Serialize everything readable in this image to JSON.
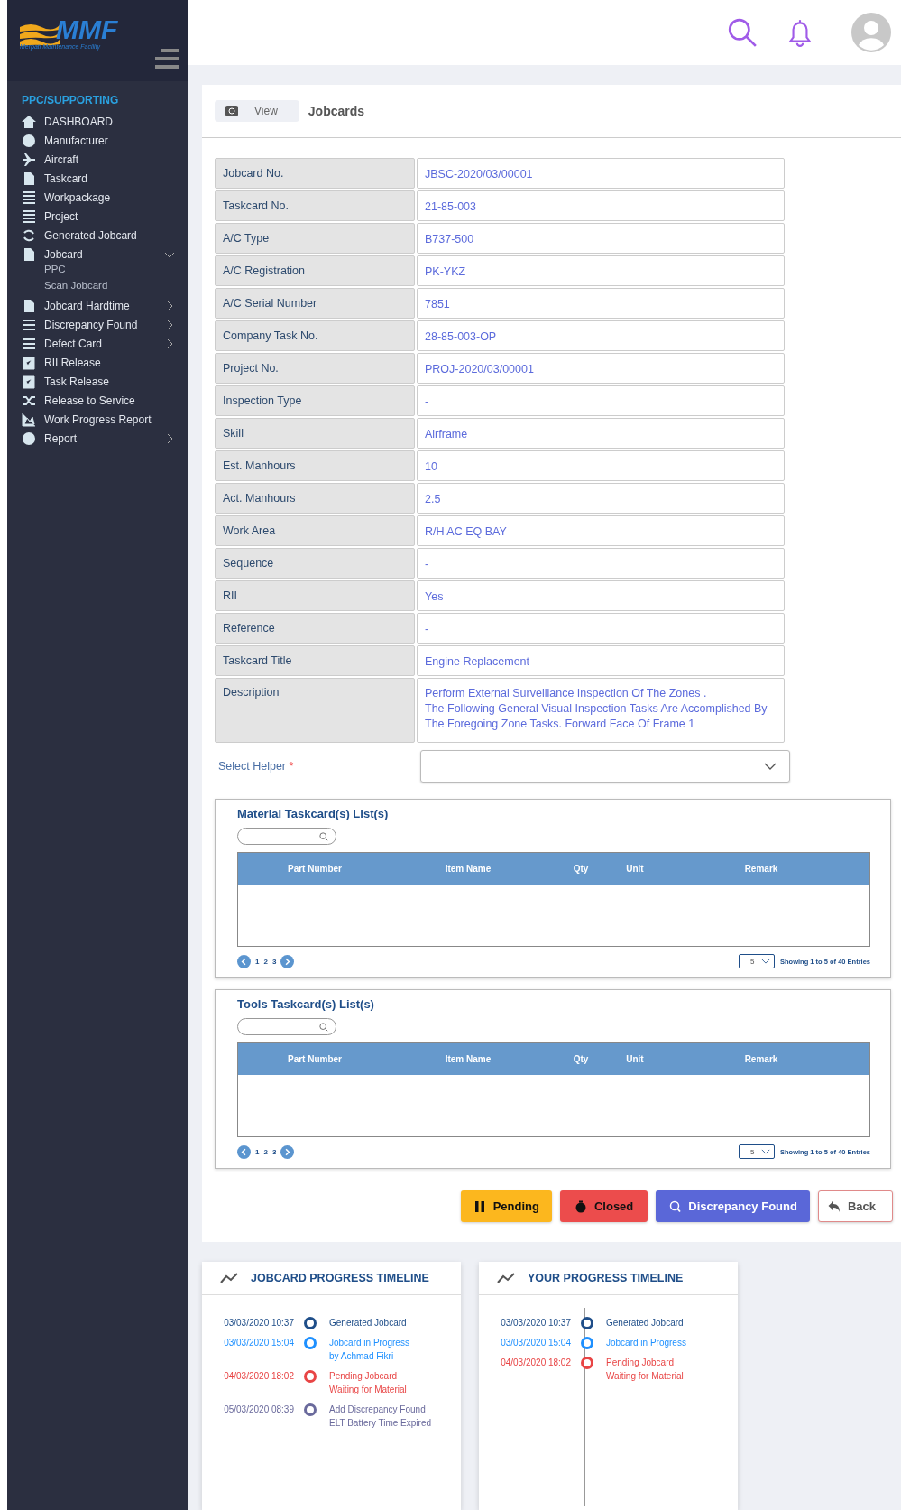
{
  "sidebar": {
    "logo_text": "MMF",
    "logo_subtitle": "Merpati Maintenance Facility",
    "section": "PPC/SUPPORTING",
    "items": [
      {
        "label": "DASHBOARD",
        "kind": "link"
      },
      {
        "label": "Manufacturer",
        "kind": "link"
      },
      {
        "label": "Aircraft",
        "kind": "link"
      },
      {
        "label": "Taskcard",
        "kind": "link"
      },
      {
        "label": "Workpackage",
        "kind": "link"
      },
      {
        "label": "Project",
        "kind": "link"
      },
      {
        "label": "Generated Jobcard",
        "kind": "link"
      },
      {
        "label": "Jobcard",
        "kind": "group",
        "expanded": true,
        "children": [
          {
            "label": "PPC"
          },
          {
            "label": "Scan Jobcard"
          }
        ]
      },
      {
        "label": "Jobcard Hardtime",
        "kind": "group",
        "expanded": false
      },
      {
        "label": "Discrepancy Found",
        "kind": "group",
        "expanded": false
      },
      {
        "label": "Defect Card",
        "kind": "group",
        "expanded": false
      },
      {
        "label": "RII Release",
        "kind": "link"
      },
      {
        "label": "Task Release",
        "kind": "link"
      },
      {
        "label": "Release to Service",
        "kind": "link"
      },
      {
        "label": "Work Progress Report",
        "kind": "link"
      },
      {
        "label": "Report",
        "kind": "group",
        "expanded": false
      }
    ]
  },
  "page": {
    "tab": "View",
    "title": "Jobcards"
  },
  "fields": [
    {
      "label": "Jobcard No.",
      "value": "JBSC-2020/03/00001"
    },
    {
      "label": "Taskcard No.",
      "value": "21-85-003"
    },
    {
      "label": "A/C Type",
      "value": "B737-500"
    },
    {
      "label": "A/C Registration",
      "value": "PK-YKZ"
    },
    {
      "label": "A/C Serial Number",
      "value": "7851"
    },
    {
      "label": "Company Task No.",
      "value": "28-85-003-OP"
    },
    {
      "label": "Project No.",
      "value": "PROJ-2020/03/00001"
    },
    {
      "label": "Inspection Type",
      "value": "-"
    },
    {
      "label": "Skill",
      "value": "Airframe"
    },
    {
      "label": "Est. Manhours",
      "value": "10"
    },
    {
      "label": "Act. Manhours",
      "value": "2.5"
    },
    {
      "label": "Work Area",
      "value": "R/H AC EQ BAY"
    },
    {
      "label": "Sequence",
      "value": "-"
    },
    {
      "label": "RII",
      "value": "Yes"
    },
    {
      "label": "Reference",
      "value": "-"
    },
    {
      "label": "Taskcard Title",
      "value": "Engine Replacement"
    },
    {
      "label": "Description",
      "value": "Perform External Surveillance Inspection Of The Zones .\nThe Following General Visual Inspection Tasks Are Accomplished By\nThe Foregoing Zone Tasks. Forward Face Of Frame 1"
    }
  ],
  "helper": {
    "label": "Select Helper",
    "required_mark": "*"
  },
  "tables": [
    {
      "title": "Material Taskcard(s) List(s)",
      "columns": [
        "Part Number",
        "Item Name",
        "Qty",
        "Unit",
        "Remark"
      ],
      "pages": [
        "1",
        "2",
        "3"
      ],
      "page_size": "5",
      "showing": "Showing 1 to 5 of 40 Entries"
    },
    {
      "title": "Tools Taskcard(s) List(s)",
      "columns": [
        "Part Number",
        "Item Name",
        "Qty",
        "Unit",
        "Remark"
      ],
      "pages": [
        "1",
        "2",
        "3"
      ],
      "page_size": "5",
      "showing": "Showing 1 to 5 of 40 Entries"
    }
  ],
  "actions": [
    {
      "label": "Pending",
      "kind": "pending"
    },
    {
      "label": "Closed",
      "kind": "closed"
    },
    {
      "label": "Discrepancy Found",
      "kind": "discrepancy"
    },
    {
      "label": "Back",
      "kind": "back"
    }
  ],
  "timelines": [
    {
      "title": "JOBCARD PROGRESS TIMELINE",
      "events": [
        {
          "time": "03/03/2020 10:37",
          "lines": [
            "Generated Jobcard"
          ],
          "color": "#1f4e89"
        },
        {
          "time": "03/03/2020 15:04",
          "lines": [
            "Jobcard in Progress",
            "by Achmad Fikri"
          ],
          "color": "#1e90ff"
        },
        {
          "time": "04/03/2020 18:02",
          "lines": [
            "Pending Jobcard",
            "Waiting for Material"
          ],
          "color": "#e84545"
        },
        {
          "time": "05/03/2020 08:39",
          "lines": [
            "Add Discrepancy Found",
            "ELT Battery Time Expired"
          ],
          "color": "#6a6a9c"
        }
      ]
    },
    {
      "title": "YOUR PROGRESS TIMELINE",
      "events": [
        {
          "time": "03/03/2020 10:37",
          "lines": [
            "Generated Jobcard"
          ],
          "color": "#1f4e89"
        },
        {
          "time": "03/03/2020 15:04",
          "lines": [
            "Jobcard in Progress"
          ],
          "color": "#1e90ff"
        },
        {
          "time": "04/03/2020 18:02",
          "lines": [
            "Pending Jobcard",
            "Waiting for Material"
          ],
          "color": "#e84545"
        }
      ]
    }
  ]
}
